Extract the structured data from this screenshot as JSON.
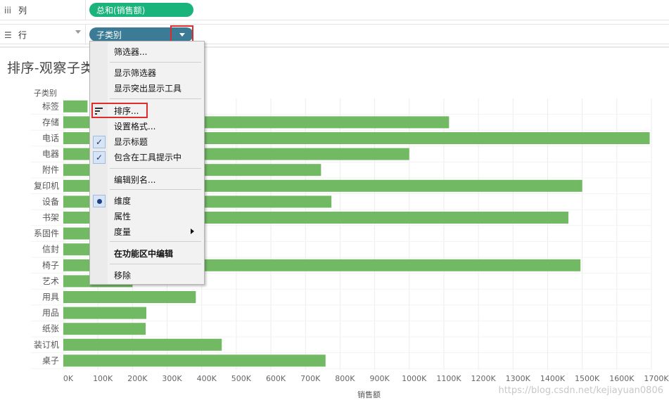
{
  "shelves": {
    "columns": {
      "label": "列",
      "icon": "iii",
      "pill": "总和(销售额)"
    },
    "rows": {
      "label": "行",
      "icon": "☰",
      "pill": "子类别"
    }
  },
  "viz": {
    "title": "排序-观察子类",
    "row_header": "子类别",
    "x_axis_title": "销售额"
  },
  "chart_data": {
    "type": "bar",
    "orientation": "horizontal",
    "categories": [
      "标签",
      "存储",
      "电话",
      "电器",
      "附件",
      "复印机",
      "设备",
      "书架",
      "系固件",
      "信封",
      "椅子",
      "艺术",
      "用具",
      "用品",
      "纸张",
      "装订机",
      "桌子"
    ],
    "values": [
      70000,
      1115000,
      1695000,
      1000000,
      745000,
      1500000,
      775000,
      1460000,
      160000,
      180000,
      1495000,
      200000,
      383000,
      240000,
      238000,
      458000,
      758000
    ],
    "xlim": [
      0,
      1700000
    ],
    "x_ticks": [
      "0K",
      "100K",
      "200K",
      "300K",
      "400K",
      "500K",
      "600K",
      "700K",
      "800K",
      "900K",
      "1000K",
      "1100K",
      "1200K",
      "1300K",
      "1400K",
      "1500K",
      "1600K",
      "1700K"
    ],
    "bar_color": "#72b963",
    "grid": true
  },
  "menu": {
    "items": [
      {
        "label": "筛选器...",
        "icon": ""
      },
      {
        "label": "显示筛选器",
        "icon": ""
      },
      {
        "label": "显示突出显示工具",
        "icon": ""
      },
      {
        "label": "排序...",
        "icon": "sort-icon"
      },
      {
        "label": "设置格式...",
        "icon": ""
      },
      {
        "label": "显示标题",
        "icon": "check-icon"
      },
      {
        "label": "包含在工具提示中",
        "icon": "check-icon"
      },
      {
        "label": "编辑别名...",
        "icon": ""
      },
      {
        "label": "维度",
        "icon": "radio-icon"
      },
      {
        "label": "属性",
        "icon": ""
      },
      {
        "label": "度量",
        "icon": "submenu-arrow-icon"
      },
      {
        "label": "在功能区中编辑",
        "icon": ""
      },
      {
        "label": "移除",
        "icon": ""
      }
    ]
  },
  "colors": {
    "measure_pill": "#19b37c",
    "dimension_pill": "#3b7b96",
    "highlight": "#e02b2b"
  },
  "watermark": "https://blog.csdn.net/kejiayuan0806"
}
